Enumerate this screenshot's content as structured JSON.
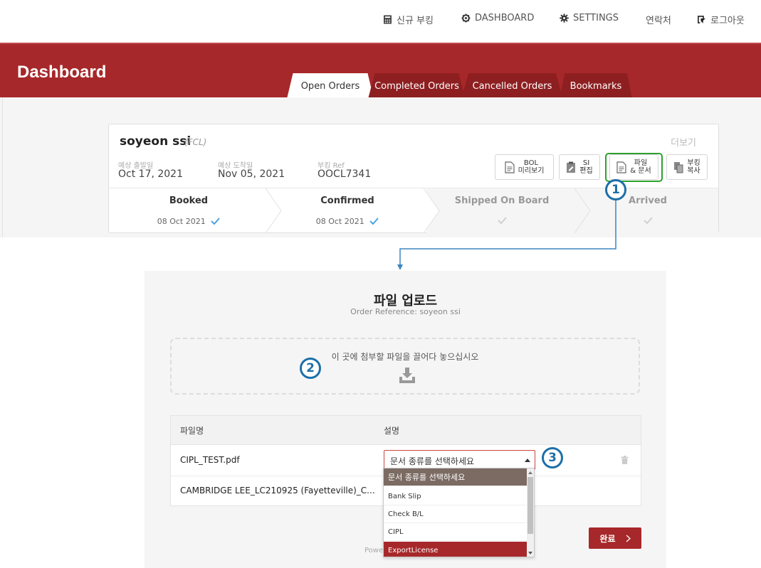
{
  "nav": {
    "new_booking": "신규 부킹",
    "dashboard": "DASHBOARD",
    "settings": "SETTINGS",
    "contact": "연락처",
    "logout": "로그아웃"
  },
  "header": {
    "title": "Dashboard",
    "tabs": [
      "Open Orders",
      "Completed Orders",
      "Cancelled Orders",
      "Bookmarks"
    ],
    "active_tab": "Open Orders"
  },
  "card": {
    "name": "soyeon ssi",
    "type": "(FCL)",
    "more": "더보기",
    "etd_label": "예상 출발일",
    "etd": "Oct 17, 2021",
    "eta_label": "예상 도착일",
    "eta": "Nov 05, 2021",
    "ref_label": "부킹 Ref",
    "ref": "OOCL7341",
    "actions": [
      {
        "line1": "BOL",
        "line2": "미리보기"
      },
      {
        "line1": "SI",
        "line2": "편집"
      },
      {
        "line1": "파일",
        "line2": "& 문서"
      },
      {
        "line1": "부킹",
        "line2": "복사"
      }
    ],
    "steps": [
      {
        "title": "Booked",
        "date": "08 Oct 2021",
        "done": true
      },
      {
        "title": "Confirmed",
        "date": "08 Oct 2021",
        "done": true
      },
      {
        "title": "Shipped On Board",
        "date": "",
        "done": false
      },
      {
        "title": "Arrived",
        "date": "",
        "done": false
      }
    ]
  },
  "callouts": [
    "1",
    "2",
    "3"
  ],
  "upload": {
    "title": "파일 업로드",
    "subtitle": "Order Reference: soyeon ssi",
    "dropzone_text": "이 곳에 첨부할 파일을 끌어다 놓으십시오",
    "col_filename": "파일명",
    "col_desc": "설명",
    "rows": [
      {
        "filename": "CIPL_TEST.pdf"
      },
      {
        "filename": "CAMBRIDGE LEE_LC210925 (Fayetteville)_C..."
      }
    ],
    "select_value": "문서 종류를 선택하세요",
    "submit": "완료",
    "powered": "Power"
  },
  "dropdown": {
    "options": [
      "문서 종류를 선택하세요",
      "Bank Slip",
      "Check B/L",
      "CIPL",
      "ExportLicense"
    ],
    "selected_index": 0,
    "hover_index": 4
  },
  "colors": {
    "brand_red": "#a7282a",
    "highlight_green": "#2ea02e",
    "callout_blue": "#1d6fa8",
    "check_blue": "#4aa3df"
  }
}
